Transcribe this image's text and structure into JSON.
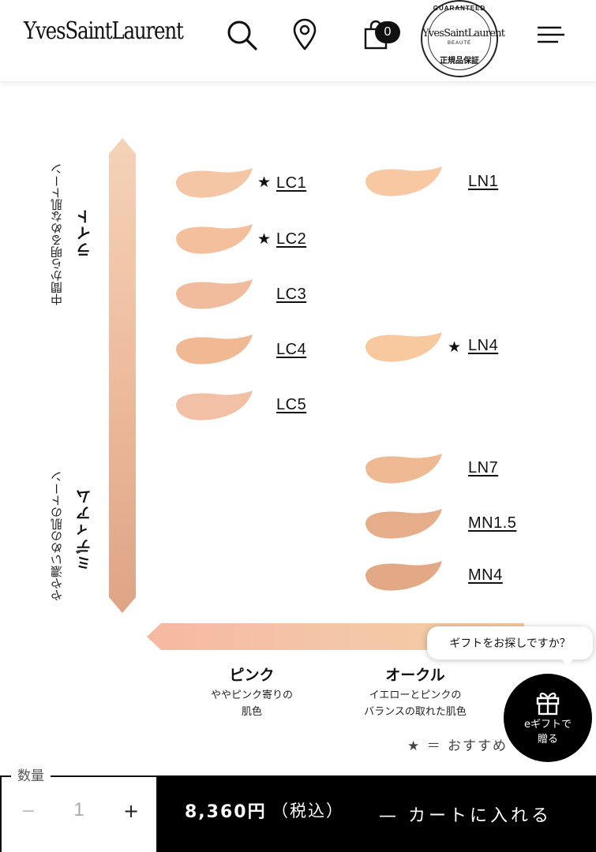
{
  "header": {
    "logo_text": "YvesSaintLaurent",
    "cart_count": "0",
    "guarantee_badge": {
      "top_text": "GUARANTEED",
      "logo_text": "YvesSaintLaurent",
      "sub_text": "BEAUTÉ",
      "bottom_text": "正規品保証"
    },
    "icons": [
      "search-icon",
      "location-pin-icon",
      "shopping-bag-icon",
      "hamburger-menu-icon"
    ]
  },
  "tone_chart": {
    "vertical_axis": {
      "light_sub": "中間から明るめな肌トーン",
      "light_main": "ライト",
      "medium_sub": "やや濃いめの肌のトーン",
      "medium_main": "ミディアム"
    },
    "pink_column": {
      "title": "ピンク",
      "description_line1": "ややピンク寄りの",
      "description_line2": "肌色",
      "shades": [
        {
          "name": "LC1",
          "starred": true,
          "color": "#f5c6a5"
        },
        {
          "name": "LC2",
          "starred": true,
          "color": "#f3bf9c"
        },
        {
          "name": "LC3",
          "starred": false,
          "color": "#f1bc9d"
        },
        {
          "name": "LC4",
          "starred": false,
          "color": "#f0b994"
        },
        {
          "name": "LC5",
          "starred": false,
          "color": "#f2c0a4"
        }
      ]
    },
    "ochre_column": {
      "title": "オークル",
      "description_line1": "イエローとピンクの",
      "description_line2": "バランスの取れた肌色",
      "shades": [
        {
          "name": "LN1",
          "starred": false,
          "color": "#f7c8a2"
        },
        {
          "name": "LN4",
          "starred": true,
          "color": "#f8c89f"
        },
        {
          "name": "LN7",
          "starred": false,
          "color": "#efb993"
        },
        {
          "name": "MN1.5",
          "starred": false,
          "color": "#e6ad8a"
        },
        {
          "name": "MN4",
          "starred": false,
          "color": "#e3a885"
        }
      ]
    },
    "star_symbol": "★",
    "legend": "★ ＝ おすすめ"
  },
  "gift": {
    "bubble_text": "ギフトをお探しですか？",
    "button_line1": "eギフトで",
    "button_line2": "贈る"
  },
  "purchase_bar": {
    "quantity_label": "数量",
    "minus": "−",
    "quantity": "1",
    "plus": "+",
    "price": "8,360円",
    "tax_note": "（税込）",
    "add_to_cart": "— カートに入れる"
  }
}
